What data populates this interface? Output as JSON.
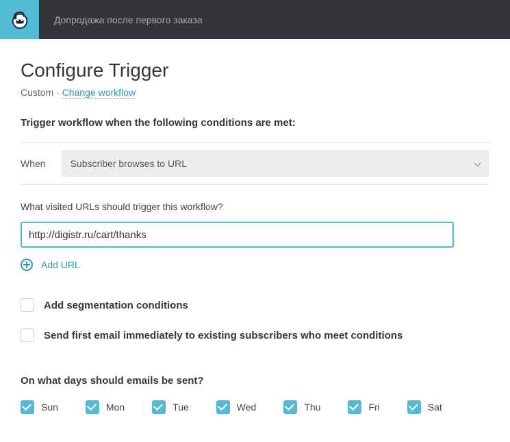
{
  "header": {
    "title": "Допродажа после первого заказа"
  },
  "page": {
    "heading": "Configure Trigger",
    "breadcrumb_prefix": "Custom · ",
    "change_workflow": "Change workflow"
  },
  "trigger": {
    "section_title": "Trigger workflow when the following conditions are met:",
    "when_label": "When",
    "when_value": "Subscriber browses to URL"
  },
  "url": {
    "label": "What visited URLs should trigger this workflow?",
    "value": "http://digistr.ru/cart/thanks",
    "add_label": "Add URL"
  },
  "options": {
    "segmentation": "Add segmentation conditions",
    "send_immediately": "Send first email immediately to existing subscribers who meet conditions"
  },
  "days": {
    "title": "On what days should emails be sent?",
    "list": [
      "Sun",
      "Mon",
      "Tue",
      "Wed",
      "Thu",
      "Fri",
      "Sat"
    ]
  }
}
